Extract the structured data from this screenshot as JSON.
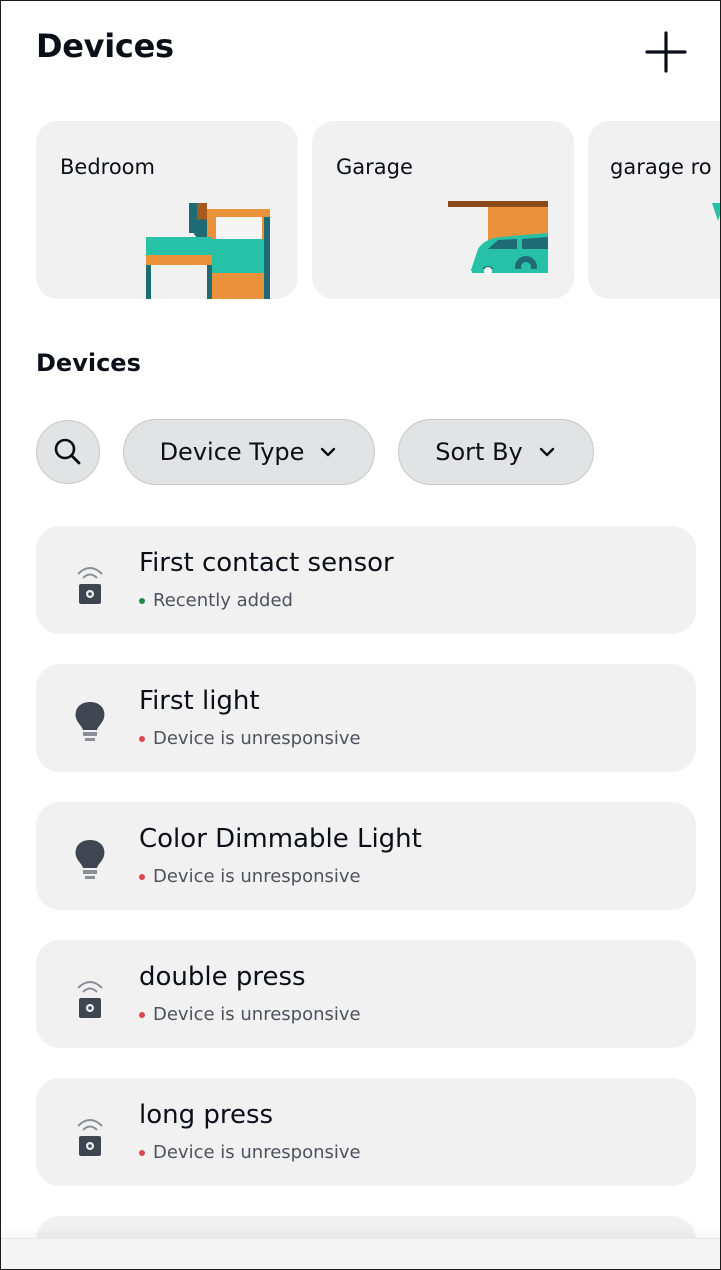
{
  "header": {
    "title": "Devices",
    "add_icon": "plus-icon"
  },
  "groups": [
    {
      "label": "Bedroom",
      "illustration": "bed"
    },
    {
      "label": "Garage",
      "illustration": "garage-car"
    },
    {
      "label": "garage ro",
      "illustration": "partial"
    }
  ],
  "section": {
    "title": "Devices"
  },
  "filters": {
    "search_icon": "search-icon",
    "device_type": "Device Type",
    "sort_by": "Sort By"
  },
  "devices": [
    {
      "name": "First contact sensor",
      "status": "Recently added",
      "status_color": "#1f8a4c",
      "icon": "contact-sensor-icon"
    },
    {
      "name": "First light",
      "status": "Device is unresponsive",
      "status_color": "#e0474c",
      "icon": "light-bulb-icon"
    },
    {
      "name": "Color Dimmable Light",
      "status": "Device is unresponsive",
      "status_color": "#e0474c",
      "icon": "light-bulb-icon"
    },
    {
      "name": "double press",
      "status": "Device is unresponsive",
      "status_color": "#e0474c",
      "icon": "contact-sensor-icon"
    },
    {
      "name": "long press",
      "status": "Device is unresponsive",
      "status_color": "#e0474c",
      "icon": "contact-sensor-icon"
    }
  ]
}
